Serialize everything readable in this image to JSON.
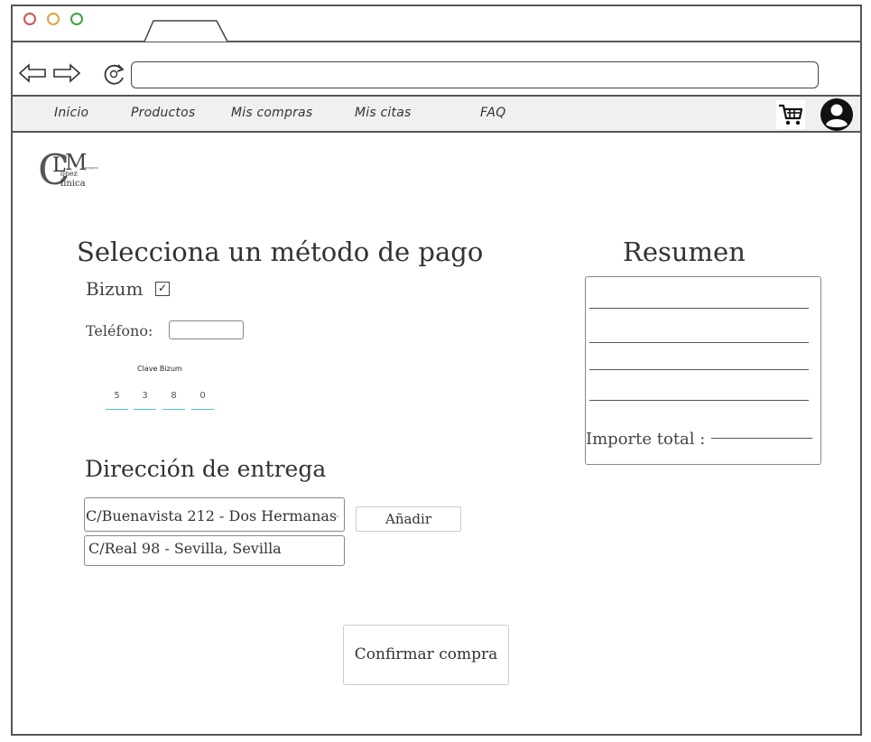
{
  "window": {
    "traffic_lights": [
      "#d9534f",
      "#e8a33a",
      "#3aa33a"
    ]
  },
  "nav": {
    "items": [
      "Inicio",
      "Productos",
      "Mis compras",
      "Mis citas",
      "FAQ"
    ],
    "cart_icon": "shopping-cart-icon",
    "profile_icon": "user-profile-icon"
  },
  "logo": {
    "big_c": "C",
    "big_l": "L",
    "big_m": "M",
    "small_text": [
      "opez",
      "línica"
    ],
    "tiny_text": "anriquez"
  },
  "payment": {
    "heading": "Selecciona un método de pago",
    "method_label": "Bizum",
    "method_checked": "✓",
    "phone_label": "Teléfono:",
    "phone_value": "",
    "pin_label": "Clave Bizum",
    "pin_digits": [
      "5",
      "3",
      "8",
      "0"
    ]
  },
  "delivery": {
    "heading": "Dirección de entrega",
    "selected_address": "C/Buenavista 212 - Dos Hermanas",
    "other_address": "C/Real 98 - Sevilla, Sevilla",
    "add_button": "Añadir"
  },
  "summary": {
    "heading": "Resumen",
    "total_label": "Importe total :"
  },
  "confirm_button": "Confirmar compra"
}
